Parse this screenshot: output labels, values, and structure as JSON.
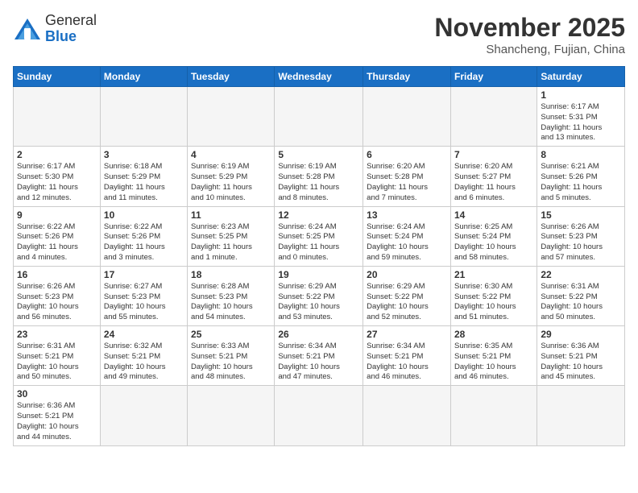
{
  "logo": {
    "text_general": "General",
    "text_blue": "Blue"
  },
  "header": {
    "month": "November 2025",
    "location": "Shancheng, Fujian, China"
  },
  "weekdays": [
    "Sunday",
    "Monday",
    "Tuesday",
    "Wednesday",
    "Thursday",
    "Friday",
    "Saturday"
  ],
  "weeks": [
    [
      {
        "day": "",
        "info": ""
      },
      {
        "day": "",
        "info": ""
      },
      {
        "day": "",
        "info": ""
      },
      {
        "day": "",
        "info": ""
      },
      {
        "day": "",
        "info": ""
      },
      {
        "day": "",
        "info": ""
      },
      {
        "day": "1",
        "info": "Sunrise: 6:17 AM\nSunset: 5:31 PM\nDaylight: 11 hours\nand 13 minutes."
      }
    ],
    [
      {
        "day": "2",
        "info": "Sunrise: 6:17 AM\nSunset: 5:30 PM\nDaylight: 11 hours\nand 12 minutes."
      },
      {
        "day": "3",
        "info": "Sunrise: 6:18 AM\nSunset: 5:29 PM\nDaylight: 11 hours\nand 11 minutes."
      },
      {
        "day": "4",
        "info": "Sunrise: 6:19 AM\nSunset: 5:29 PM\nDaylight: 11 hours\nand 10 minutes."
      },
      {
        "day": "5",
        "info": "Sunrise: 6:19 AM\nSunset: 5:28 PM\nDaylight: 11 hours\nand 8 minutes."
      },
      {
        "day": "6",
        "info": "Sunrise: 6:20 AM\nSunset: 5:28 PM\nDaylight: 11 hours\nand 7 minutes."
      },
      {
        "day": "7",
        "info": "Sunrise: 6:20 AM\nSunset: 5:27 PM\nDaylight: 11 hours\nand 6 minutes."
      },
      {
        "day": "8",
        "info": "Sunrise: 6:21 AM\nSunset: 5:26 PM\nDaylight: 11 hours\nand 5 minutes."
      }
    ],
    [
      {
        "day": "9",
        "info": "Sunrise: 6:22 AM\nSunset: 5:26 PM\nDaylight: 11 hours\nand 4 minutes."
      },
      {
        "day": "10",
        "info": "Sunrise: 6:22 AM\nSunset: 5:26 PM\nDaylight: 11 hours\nand 3 minutes."
      },
      {
        "day": "11",
        "info": "Sunrise: 6:23 AM\nSunset: 5:25 PM\nDaylight: 11 hours\nand 1 minute."
      },
      {
        "day": "12",
        "info": "Sunrise: 6:24 AM\nSunset: 5:25 PM\nDaylight: 11 hours\nand 0 minutes."
      },
      {
        "day": "13",
        "info": "Sunrise: 6:24 AM\nSunset: 5:24 PM\nDaylight: 10 hours\nand 59 minutes."
      },
      {
        "day": "14",
        "info": "Sunrise: 6:25 AM\nSunset: 5:24 PM\nDaylight: 10 hours\nand 58 minutes."
      },
      {
        "day": "15",
        "info": "Sunrise: 6:26 AM\nSunset: 5:23 PM\nDaylight: 10 hours\nand 57 minutes."
      }
    ],
    [
      {
        "day": "16",
        "info": "Sunrise: 6:26 AM\nSunset: 5:23 PM\nDaylight: 10 hours\nand 56 minutes."
      },
      {
        "day": "17",
        "info": "Sunrise: 6:27 AM\nSunset: 5:23 PM\nDaylight: 10 hours\nand 55 minutes."
      },
      {
        "day": "18",
        "info": "Sunrise: 6:28 AM\nSunset: 5:23 PM\nDaylight: 10 hours\nand 54 minutes."
      },
      {
        "day": "19",
        "info": "Sunrise: 6:29 AM\nSunset: 5:22 PM\nDaylight: 10 hours\nand 53 minutes."
      },
      {
        "day": "20",
        "info": "Sunrise: 6:29 AM\nSunset: 5:22 PM\nDaylight: 10 hours\nand 52 minutes."
      },
      {
        "day": "21",
        "info": "Sunrise: 6:30 AM\nSunset: 5:22 PM\nDaylight: 10 hours\nand 51 minutes."
      },
      {
        "day": "22",
        "info": "Sunrise: 6:31 AM\nSunset: 5:22 PM\nDaylight: 10 hours\nand 50 minutes."
      }
    ],
    [
      {
        "day": "23",
        "info": "Sunrise: 6:31 AM\nSunset: 5:21 PM\nDaylight: 10 hours\nand 50 minutes."
      },
      {
        "day": "24",
        "info": "Sunrise: 6:32 AM\nSunset: 5:21 PM\nDaylight: 10 hours\nand 49 minutes."
      },
      {
        "day": "25",
        "info": "Sunrise: 6:33 AM\nSunset: 5:21 PM\nDaylight: 10 hours\nand 48 minutes."
      },
      {
        "day": "26",
        "info": "Sunrise: 6:34 AM\nSunset: 5:21 PM\nDaylight: 10 hours\nand 47 minutes."
      },
      {
        "day": "27",
        "info": "Sunrise: 6:34 AM\nSunset: 5:21 PM\nDaylight: 10 hours\nand 46 minutes."
      },
      {
        "day": "28",
        "info": "Sunrise: 6:35 AM\nSunset: 5:21 PM\nDaylight: 10 hours\nand 46 minutes."
      },
      {
        "day": "29",
        "info": "Sunrise: 6:36 AM\nSunset: 5:21 PM\nDaylight: 10 hours\nand 45 minutes."
      }
    ],
    [
      {
        "day": "30",
        "info": "Sunrise: 6:36 AM\nSunset: 5:21 PM\nDaylight: 10 hours\nand 44 minutes."
      },
      {
        "day": "",
        "info": ""
      },
      {
        "day": "",
        "info": ""
      },
      {
        "day": "",
        "info": ""
      },
      {
        "day": "",
        "info": ""
      },
      {
        "day": "",
        "info": ""
      },
      {
        "day": "",
        "info": ""
      }
    ]
  ]
}
